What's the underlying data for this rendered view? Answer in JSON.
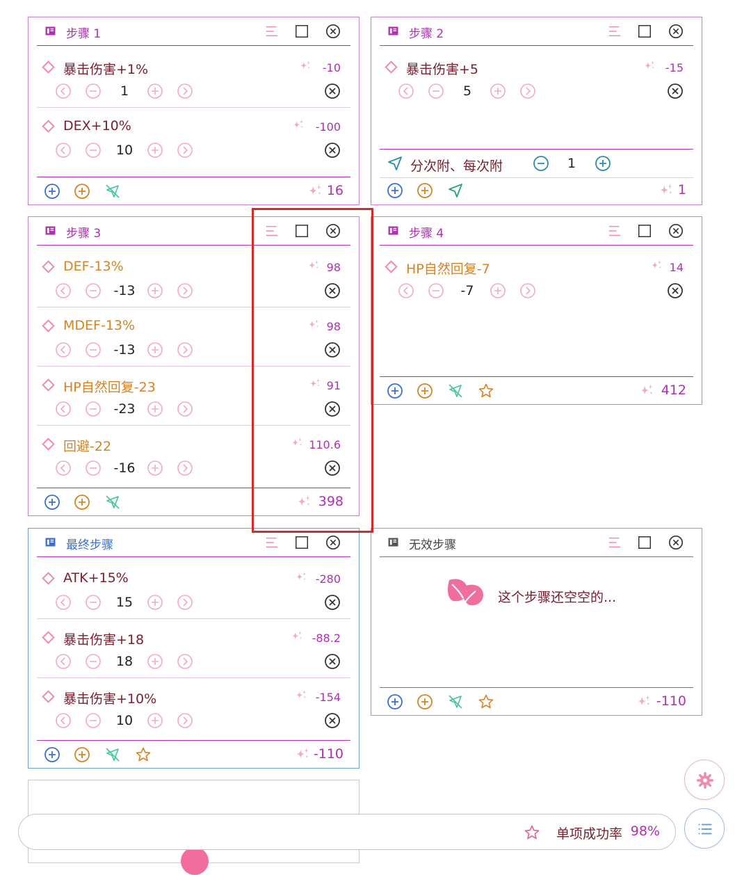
{
  "cards": {
    "step1": {
      "title": "步骤 1",
      "items": [
        {
          "name": "暴击伤害+1%",
          "score": "-10",
          "value": "1"
        },
        {
          "name": "DEX+10%",
          "score": "-100",
          "value": "10"
        }
      ],
      "total": "16"
    },
    "step2": {
      "title": "步骤 2",
      "items": [
        {
          "name": "暴击伤害+5",
          "score": "-15",
          "value": "5"
        }
      ],
      "attach": {
        "label": "分次附、每次附",
        "value": "1"
      },
      "total": "1"
    },
    "step3": {
      "title": "步骤 3",
      "items": [
        {
          "name": "DEF-13%",
          "score": "98",
          "value": "-13"
        },
        {
          "name": "MDEF-13%",
          "score": "98",
          "value": "-13"
        },
        {
          "name": "HP自然回复-23",
          "score": "91",
          "value": "-23"
        },
        {
          "name": "回避-22",
          "score": "110.6",
          "value": "-16"
        }
      ],
      "total": "398"
    },
    "step4": {
      "title": "步骤 4",
      "items": [
        {
          "name": "HP自然回复-7",
          "score": "14",
          "value": "-7"
        }
      ],
      "total": "412"
    },
    "final": {
      "title": "最终步骤",
      "items": [
        {
          "name": "ATK+15%",
          "score": "-280",
          "value": "15"
        },
        {
          "name": "暴击伤害+18",
          "score": "-88.2",
          "value": "18"
        },
        {
          "name": "暴击伤害+10%",
          "score": "-154",
          "value": "10"
        }
      ],
      "total": "-110"
    },
    "invalid": {
      "title": "无效步骤",
      "empty_text": "这个步骤还空空的...",
      "total": "-110"
    }
  },
  "bottom_bar": {
    "label": "单项成功率",
    "value": "98%"
  },
  "icons": {
    "book": "book-icon",
    "menu": "menu-lines-icon",
    "checkbox": "checkbox-icon",
    "close": "close-circle-icon",
    "diamond": "diamond-icon",
    "sparkle": "sparkle-icon",
    "prev": "chevron-left-circle-icon",
    "minus": "minus-circle-icon",
    "plus": "plus-circle-icon",
    "next": "chevron-right-circle-icon",
    "add": "add-circle-icon",
    "pin-off": "navigation-off-icon",
    "pin": "navigation-icon",
    "star": "star-icon",
    "leaf": "leaf-icon",
    "gear": "gear-icon",
    "list": "list-icon"
  },
  "colors": {
    "purple": "#b02fb4",
    "dark_red": "#7a1c2c",
    "orange": "#d9821f",
    "pink": "#f08bb0",
    "blue": "#3b6fd0",
    "green": "#2aa37a",
    "highlight": "#d32a2a"
  }
}
